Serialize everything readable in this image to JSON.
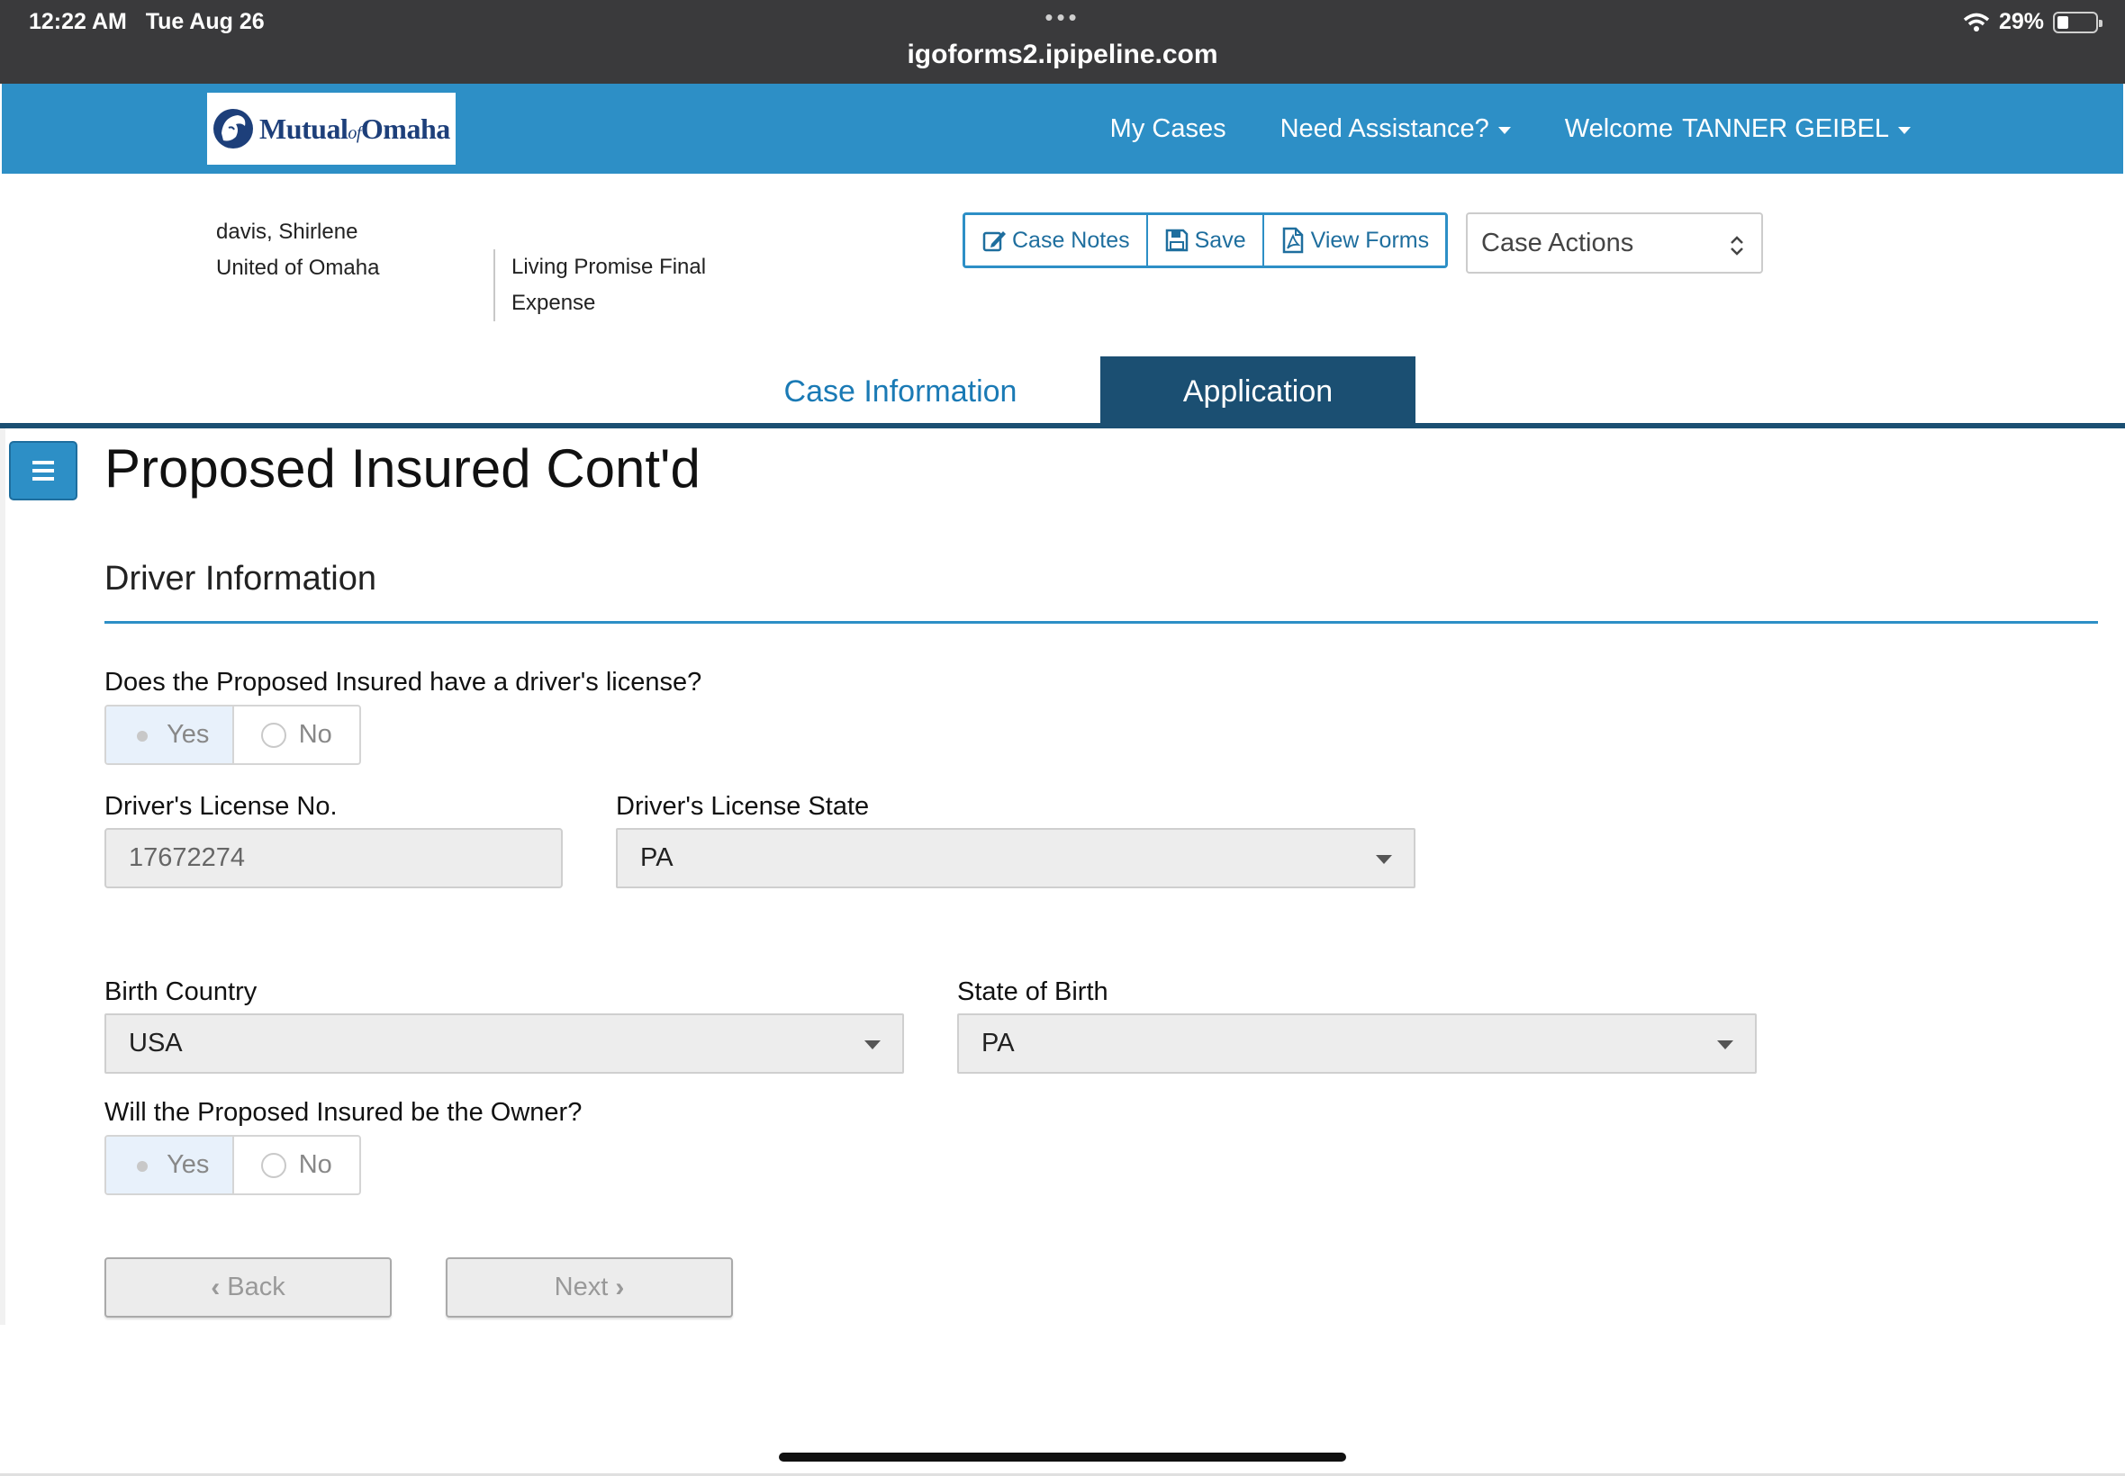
{
  "status_bar": {
    "time": "12:22 AM",
    "date": "Tue Aug 26",
    "dots": "•••",
    "url": "igoforms2.ipipeline.com",
    "battery": "29%",
    "battery_level": 0.29
  },
  "navbar": {
    "logo_text": "Mutual",
    "logo_of": "of",
    "logo_text2": "Omaha",
    "links": {
      "my_cases": "My Cases",
      "need_assistance": "Need Assistance?",
      "welcome_prefix": "Welcome",
      "welcome_name": "TANNER GEIBEL"
    },
    "color": "#2d8fc6"
  },
  "case_header": {
    "client_name": "davis, Shirlene",
    "company": "United of Omaha",
    "product": "Living Promise Final Expense",
    "buttons": {
      "case_notes": "Case Notes",
      "save": "Save",
      "view_forms": "View Forms"
    },
    "case_actions": "Case Actions"
  },
  "tabs": {
    "case_information": "Case Information",
    "application": "Application",
    "active": "Application"
  },
  "page": {
    "title": "Proposed Insured Cont'd",
    "section": "Driver Information"
  },
  "form": {
    "q_license": "Does the Proposed Insured have a driver's license?",
    "license_yes": "Yes",
    "license_no": "No",
    "license_selected": "Yes",
    "license_no_label": "Driver's License No.",
    "license_no_value": "17672274",
    "license_state_label": "Driver's License State",
    "license_state_value": "PA",
    "birth_country_label": "Birth Country",
    "birth_country_value": "USA",
    "state_of_birth_label": "State of Birth",
    "state_of_birth_value": "PA",
    "q_owner": "Will the Proposed Insured be the Owner?",
    "owner_yes": "Yes",
    "owner_no": "No",
    "owner_selected": "Yes"
  },
  "footer_buttons": {
    "back": "Back",
    "next": "Next"
  }
}
